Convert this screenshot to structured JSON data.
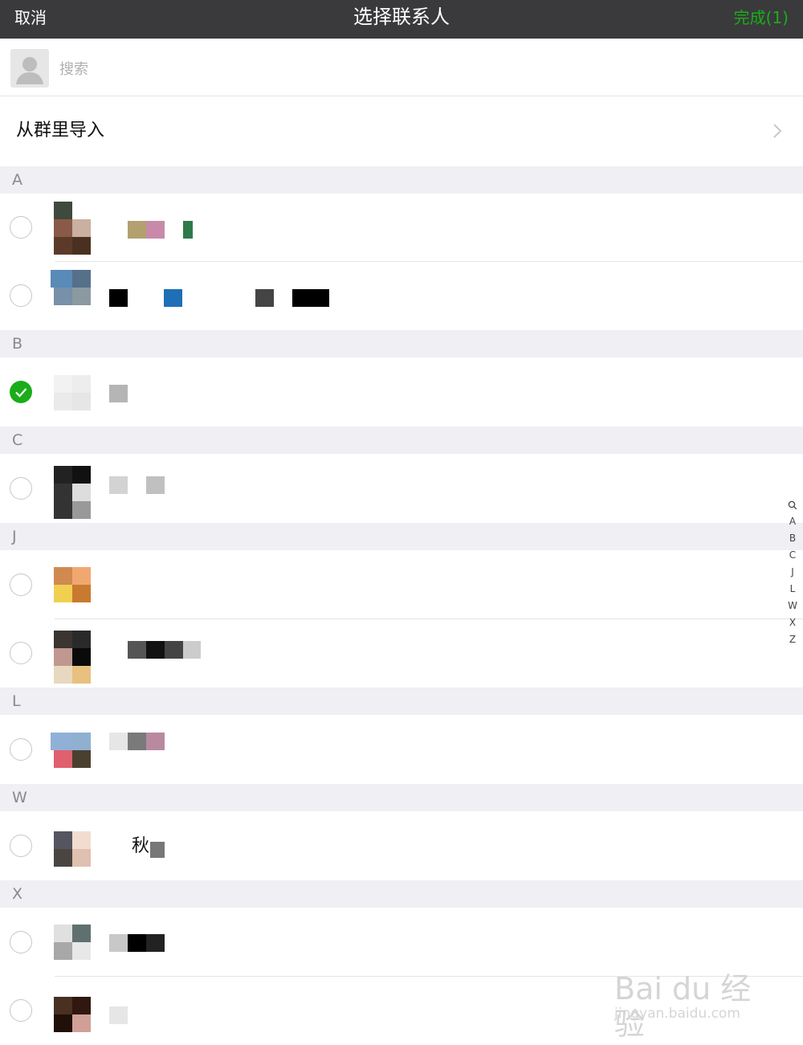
{
  "navbar": {
    "cancel": "取消",
    "title": "选择联系人",
    "done": "完成(1)"
  },
  "search": {
    "placeholder": "搜索"
  },
  "import_from_group": "从群里导入",
  "sections": [
    {
      "letter": "A",
      "contacts": [
        {
          "checked": false
        },
        {
          "checked": false
        }
      ]
    },
    {
      "letter": "B",
      "contacts": [
        {
          "checked": true
        }
      ]
    },
    {
      "letter": "C",
      "contacts": [
        {
          "checked": false
        }
      ]
    },
    {
      "letter": "J",
      "contacts": [
        {
          "checked": false
        },
        {
          "checked": false
        }
      ]
    },
    {
      "letter": "L",
      "contacts": [
        {
          "checked": false
        }
      ]
    },
    {
      "letter": "W",
      "contacts": [
        {
          "checked": false,
          "name_visible": "秋"
        }
      ]
    },
    {
      "letter": "X",
      "contacts": [
        {
          "checked": false
        },
        {
          "checked": false
        }
      ]
    }
  ],
  "index_bar": [
    "A",
    "B",
    "C",
    "J",
    "L",
    "W",
    "X",
    "Z"
  ],
  "watermark": {
    "main": "Bai du 经验",
    "sub": "jingyan.baidu.com"
  },
  "colors": {
    "navbar": "#3a3a3c",
    "accent_green": "#1aad19",
    "section_bg": "#efeff4",
    "divider": "#e5e5e5"
  }
}
